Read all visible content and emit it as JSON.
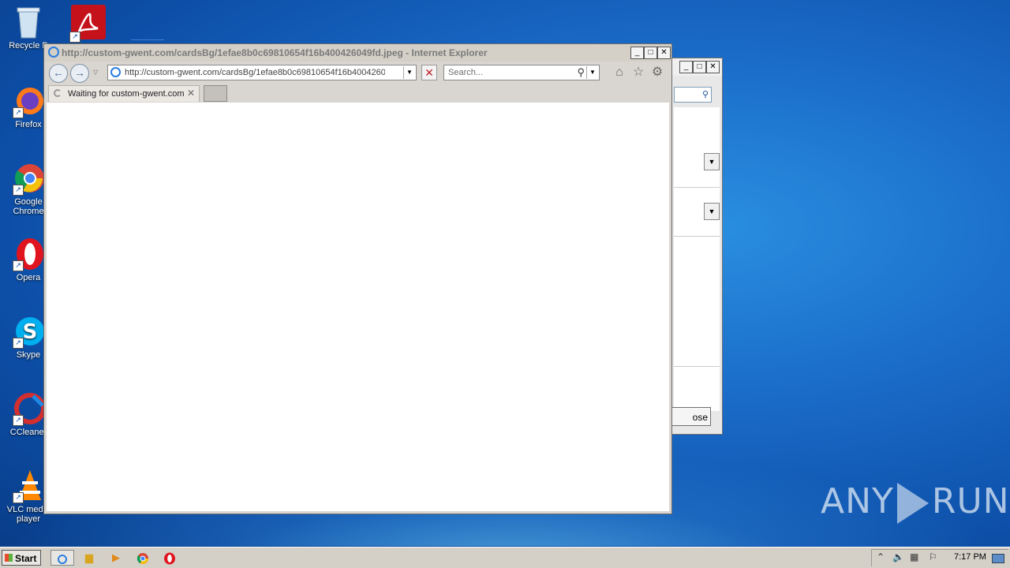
{
  "desktop": {
    "icons": [
      {
        "label": "Recycle B",
        "icon": "recycle-bin-icon"
      },
      {
        "label": "Firefox",
        "icon": "firefox-icon"
      },
      {
        "label": "Google Chrome",
        "icon": "chrome-icon"
      },
      {
        "label": "Opera",
        "icon": "opera-icon"
      },
      {
        "label": "Skype",
        "icon": "skype-icon"
      },
      {
        "label": "CCleaner",
        "icon": "ccleaner-icon"
      },
      {
        "label": "VLC media player",
        "icon": "vlc-icon"
      }
    ],
    "acrobat_icon": "acrobat-icon",
    "watermark": {
      "left": "ANY",
      "right": "RUN"
    }
  },
  "background_window": {
    "close_button_label": "ose"
  },
  "browser": {
    "title": "http://custom-gwent.com/cardsBg/1efae8b0c69810654f16b400426049fd.jpeg - Internet Explorer",
    "address": "http://custom-gwent.com/cardsBg/1efae8b0c69810654f16b400426049fd",
    "search_placeholder": "Search...",
    "tab_label": "Waiting for custom-gwent.com",
    "tab_close": "✕",
    "stop_symbol": "✕"
  },
  "taskbar": {
    "start_label": "Start",
    "clock": "7:17 PM"
  }
}
